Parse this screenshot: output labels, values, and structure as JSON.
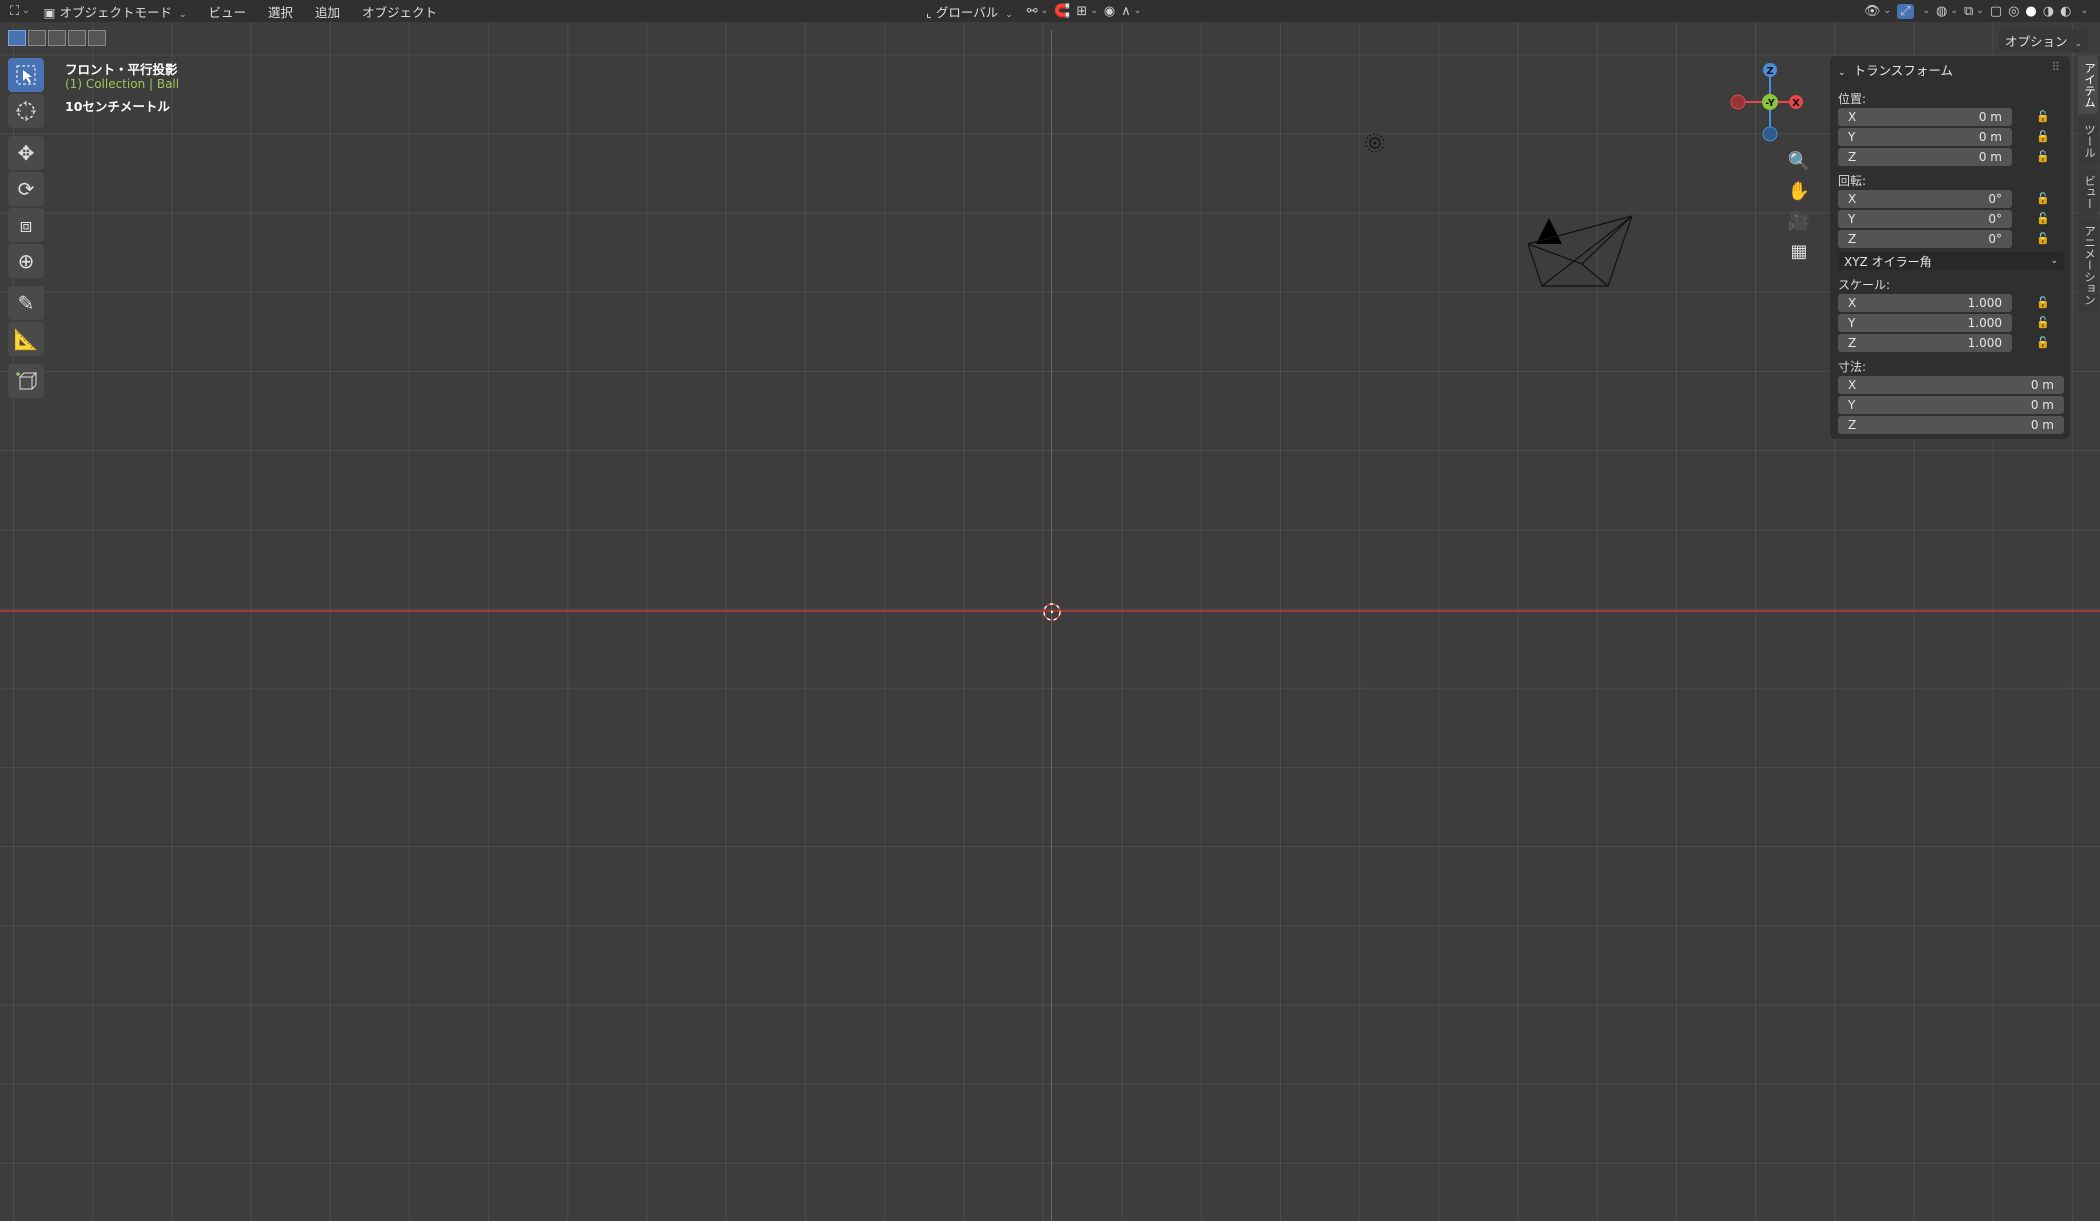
{
  "header": {
    "mode_label": "オブジェクトモード",
    "menus": [
      "ビュー",
      "選択",
      "追加",
      "オブジェクト"
    ],
    "transform_orientation": "グローバル",
    "options_label": "オプション"
  },
  "overlay": {
    "view_name": "フロント・平行投影",
    "collection_info": "(1) Collection | Ball",
    "grid_scale": "10センチメートル"
  },
  "gizmo": {
    "z": "Z",
    "y": "-Y",
    "x": "X",
    "colors": {
      "x": "#e5474c",
      "y": "#8bc53f",
      "z": "#4b8ed9"
    }
  },
  "toolbar": {
    "tools": [
      "select-box",
      "cursor",
      "move",
      "rotate",
      "scale",
      "transform",
      "annotate",
      "measure",
      "add-cube"
    ]
  },
  "npanel": {
    "section_title": "トランスフォーム",
    "location": {
      "label": "位置:",
      "x": "0 m",
      "y": "0 m",
      "z": "0 m"
    },
    "rotation": {
      "label": "回転:",
      "x": "0°",
      "y": "0°",
      "z": "0°"
    },
    "rotation_mode": "XYZ オイラー角",
    "scale": {
      "label": "スケール:",
      "x": "1.000",
      "y": "1.000",
      "z": "1.000"
    },
    "dimensions": {
      "label": "寸法:",
      "x": "0 m",
      "y": "0 m",
      "z": "0 m"
    },
    "axis_x": "X",
    "axis_y": "Y",
    "axis_z": "Z"
  },
  "tabs": [
    "アイテム",
    "ツール",
    "ビュー",
    "アニメーション"
  ]
}
